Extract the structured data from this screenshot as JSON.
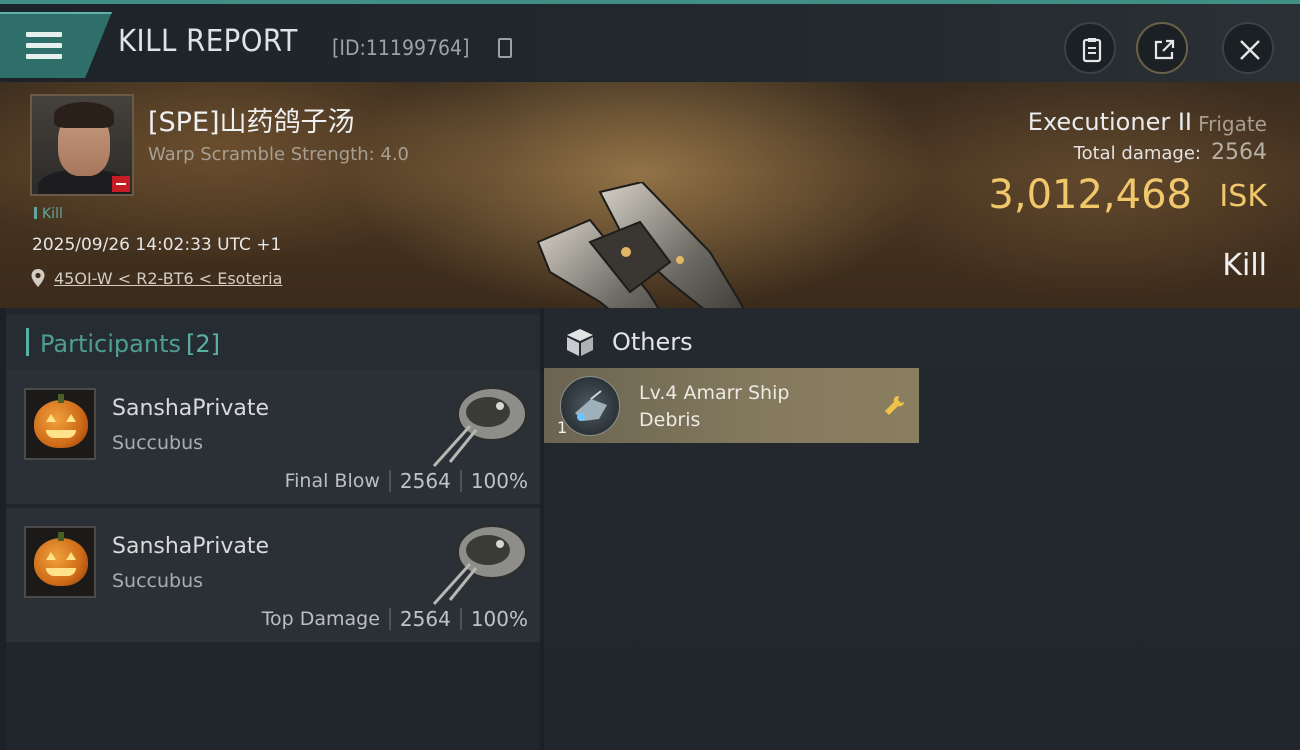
{
  "header": {
    "title": "KILL REPORT",
    "report_id": "[ID:11199764]",
    "icons": [
      "menu-icon",
      "copy-icon",
      "clipboard-icon",
      "share-icon",
      "close-icon"
    ]
  },
  "victim": {
    "pilot_name": "[SPE]山药鸽子汤",
    "scramble": "Warp Scramble Strength: 4.0",
    "tag": "Kill",
    "timestamp": "2025/09/26 14:02:33 UTC +1",
    "location": "45OI-W < R2-BT6 < Esoteria",
    "ship_name": "Executioner II",
    "ship_class": "Frigate",
    "damage_label": "Total damage:",
    "damage_value": "2564",
    "isk_value": "3,012,468",
    "isk_unit": "ISK",
    "result": "Kill"
  },
  "participants": {
    "label": "Participants",
    "count": "[2]",
    "rows": [
      {
        "name": "SanshaPrivate",
        "ship": "Succubus",
        "role": "Final Blow",
        "damage": "2564",
        "percent": "100%"
      },
      {
        "name": "SanshaPrivate",
        "ship": "Succubus",
        "role": "Top Damage",
        "damage": "2564",
        "percent": "100%"
      }
    ]
  },
  "others": {
    "label": "Others",
    "items": [
      {
        "qty": "1",
        "name": "Lv.4 Amarr Ship Debris"
      }
    ]
  },
  "colors": {
    "accent_teal": "#5ab2a7",
    "isk_gold": "#f0c86b",
    "item_card": "#857a5e"
  }
}
